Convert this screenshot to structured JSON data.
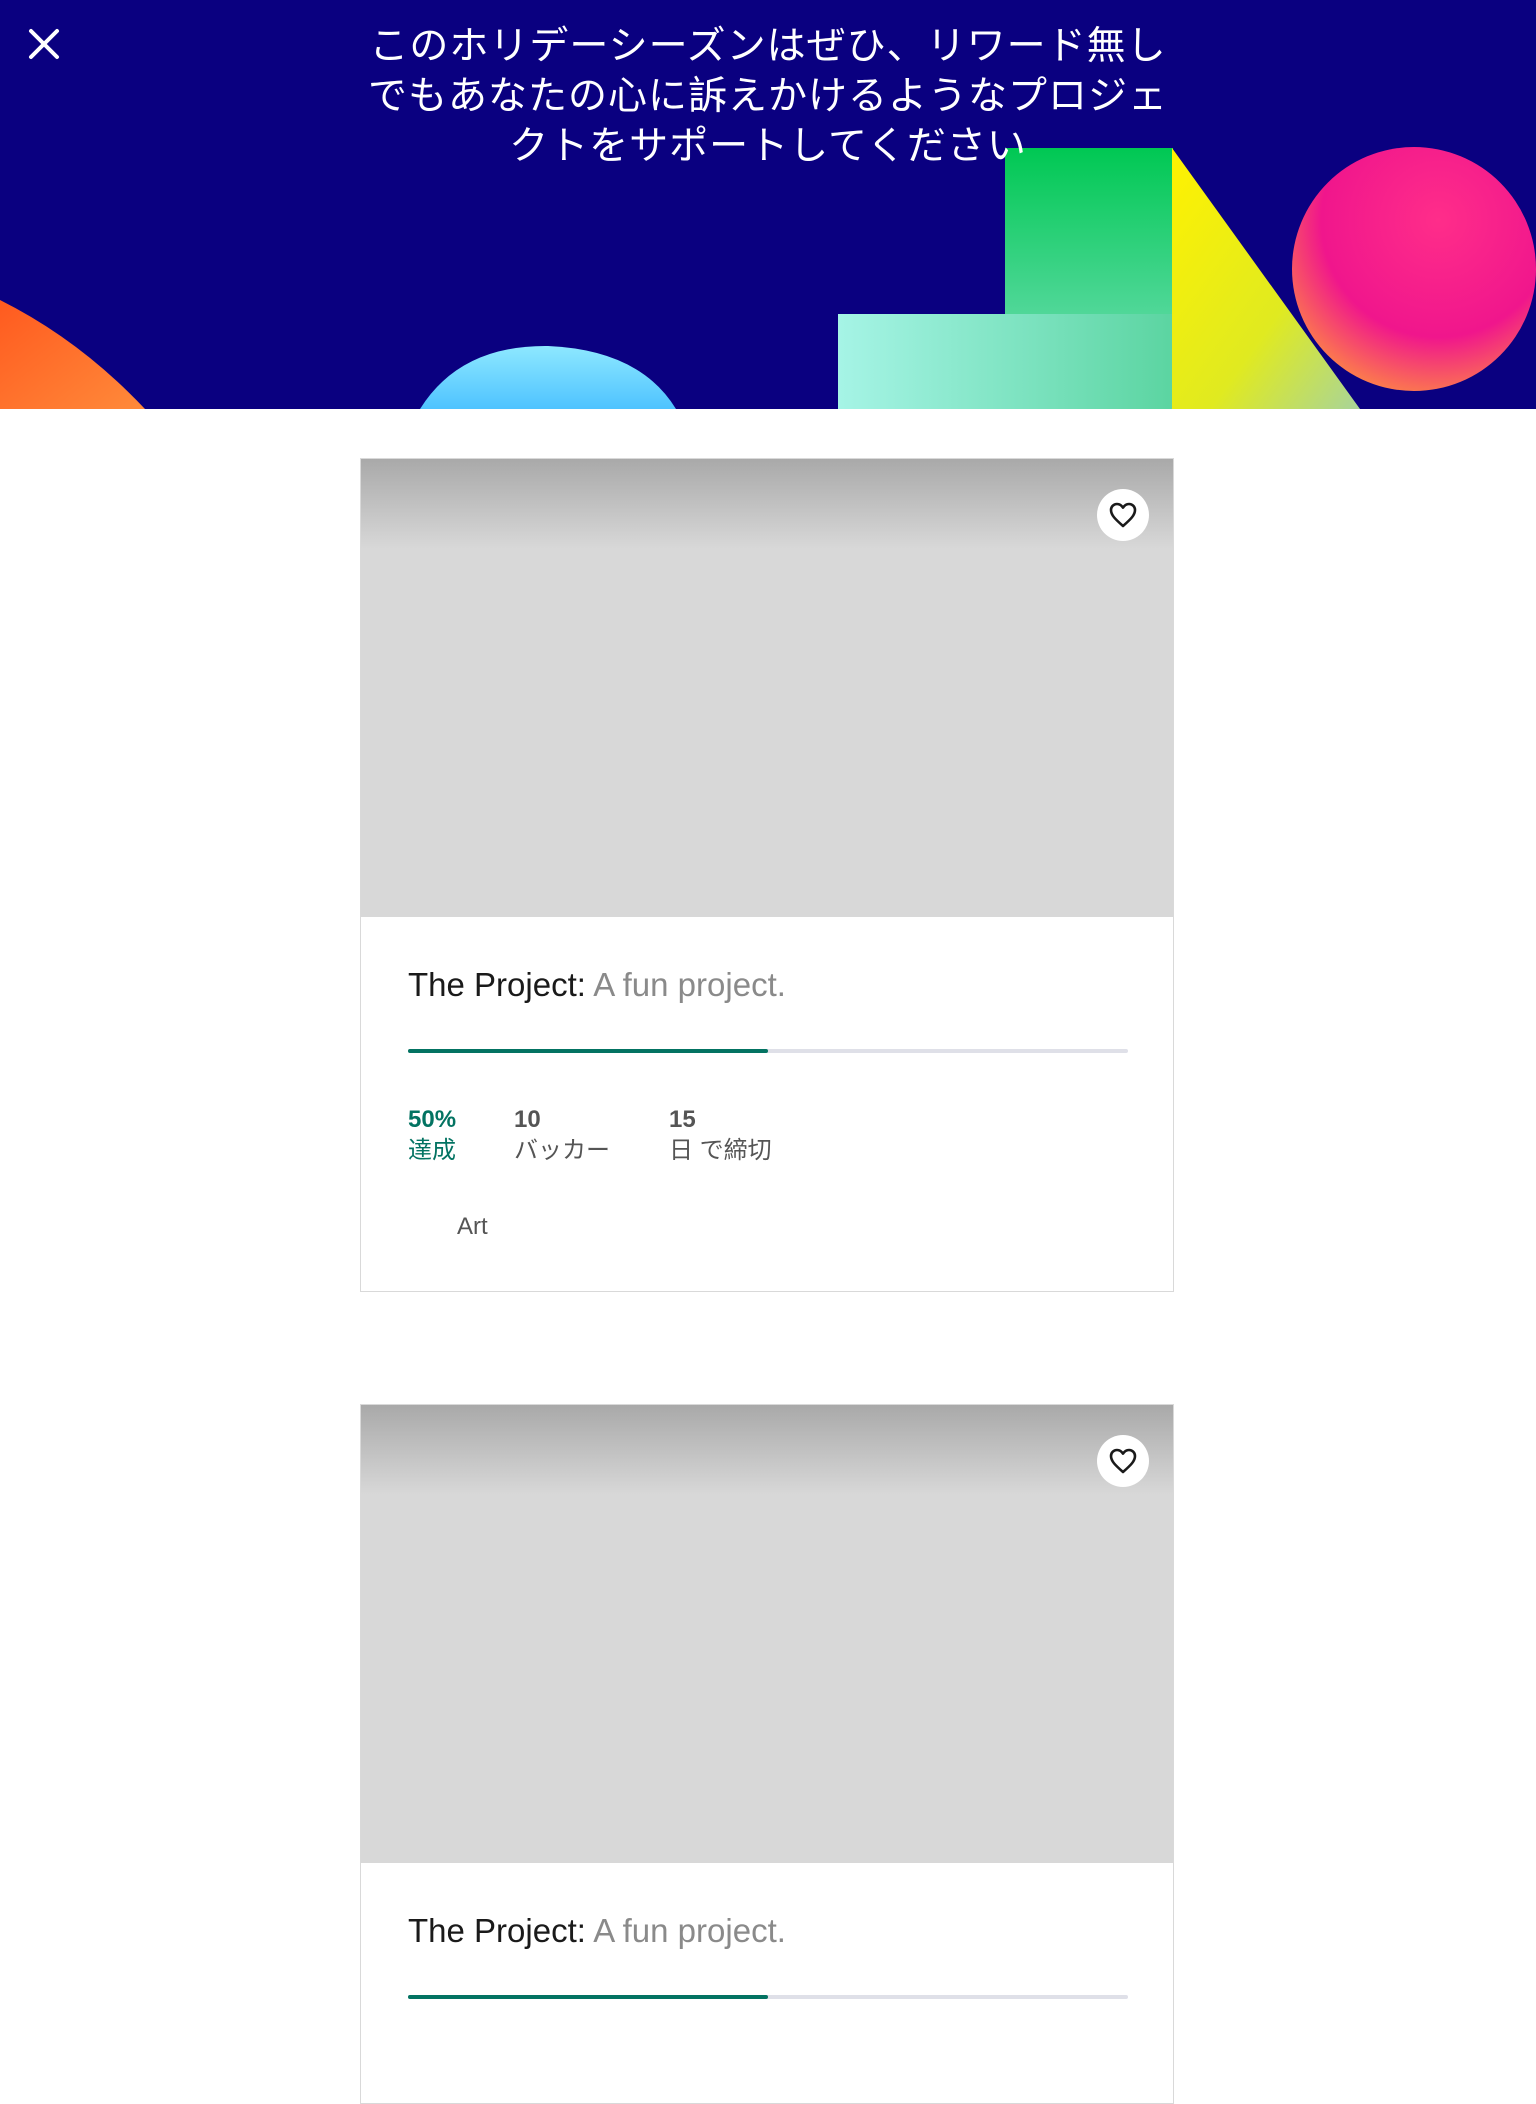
{
  "header": {
    "title_lines": [
      "このホリデーシーズンはぜひ、リワード無し",
      "でもあなたの心に訴えかけるようなプロジェ",
      "クトをサポートしてください"
    ],
    "background_color": "#0a0080",
    "close_icon": "close-icon"
  },
  "projects": [
    {
      "name": "The Project:",
      "blurb": "A fun project.",
      "percent_funded": 50,
      "stats": {
        "funded_value": "50%",
        "funded_label": "達成",
        "backers_value": "10",
        "backers_label": "バッカー",
        "days_value": "15",
        "days_label": "日 で締切"
      },
      "category": "Art",
      "heart_icon": "heart-icon"
    },
    {
      "name": "The Project:",
      "blurb": "A fun project.",
      "percent_funded": 50,
      "heart_icon": "heart-icon"
    }
  ],
  "colors": {
    "accent_green": "#037362",
    "progress_track": "#dfe0e8",
    "header_blue": "#0a0080"
  }
}
